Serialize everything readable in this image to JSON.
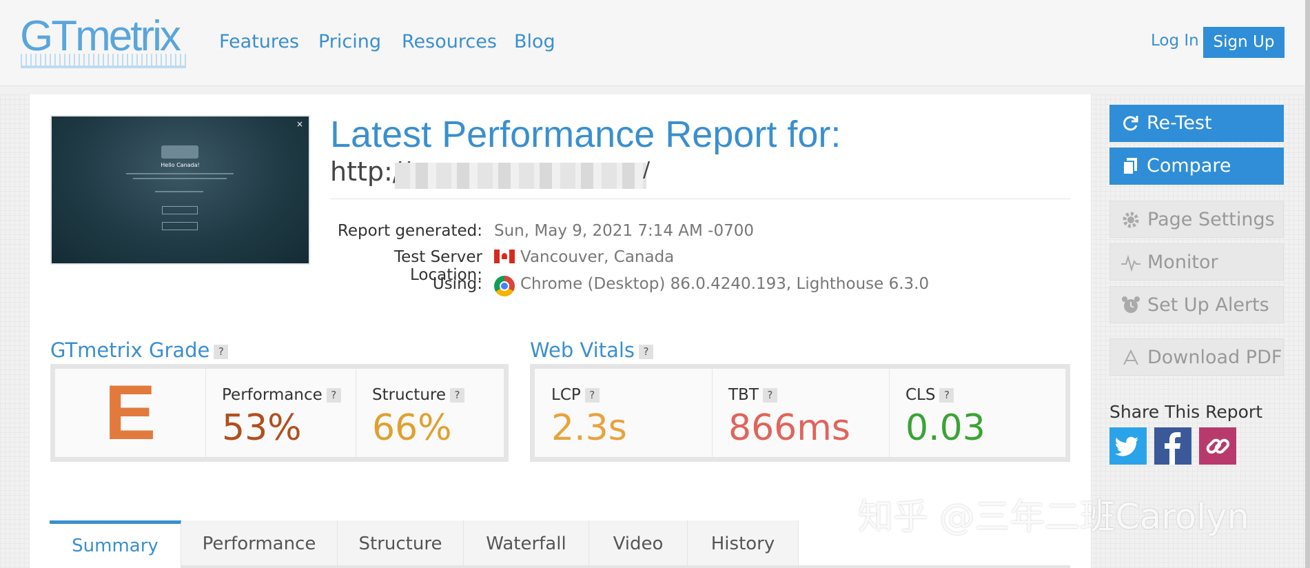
{
  "header": {
    "logo": "GTmetrix",
    "nav": [
      "Features",
      "Pricing",
      "Resources",
      "Blog"
    ],
    "login": "Log In",
    "signup": "Sign Up"
  },
  "report": {
    "heading": "Latest Performance Report for:",
    "url": "http://",
    "url_suffix": "/",
    "meta": [
      {
        "label": "Report generated:",
        "value": "Sun, May 9, 2021 7:14 AM -0700"
      },
      {
        "label": "Test Server Location:",
        "value": "Vancouver, Canada"
      },
      {
        "label": "Using:",
        "value": "Chrome (Desktop) 86.0.4240.193, Lighthouse 6.3.0"
      }
    ],
    "thumbnail": {
      "heading": "Hello Canada!",
      "close": "×"
    }
  },
  "grade": {
    "title": "GTmetrix Grade",
    "help": "?",
    "letter": "E",
    "performance_label": "Performance",
    "performance_value": "53%",
    "structure_label": "Structure",
    "structure_value": "66%"
  },
  "vitals": {
    "title": "Web Vitals",
    "help": "?",
    "items": [
      {
        "label": "LCP",
        "value": "2.3s",
        "color": "#e8a33d"
      },
      {
        "label": "TBT",
        "value": "866ms",
        "color": "#e0645c"
      },
      {
        "label": "CLS",
        "value": "0.03",
        "color": "#3aa335"
      }
    ]
  },
  "sidebar": {
    "retest": "Re-Test",
    "compare": "Compare",
    "page_settings": "Page Settings",
    "monitor": "Monitor",
    "alerts": "Set Up Alerts",
    "pdf": "Download PDF",
    "share_title": "Share This Report"
  },
  "tabs": [
    "Summary",
    "Performance",
    "Structure",
    "Waterfall",
    "Video",
    "History"
  ],
  "watermark": "知乎 @三年二班Carolyn",
  "colors": {
    "accent": "#3a8fcf",
    "performance": "#b0501e",
    "structure": "#e0a030",
    "grade": "#e17a3c"
  }
}
